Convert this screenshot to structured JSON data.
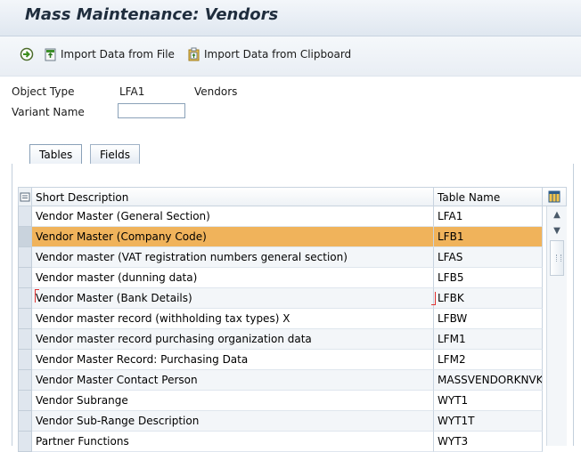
{
  "window": {
    "title": "Mass Maintenance: Vendors"
  },
  "toolbar": {
    "import_file_label": "Import Data from File",
    "import_clipboard_label": "Import Data from Clipboard"
  },
  "header": {
    "object_type_label": "Object Type",
    "object_type_code": "LFA1",
    "object_type_desc": "Vendors",
    "variant_name_label": "Variant Name",
    "variant_name_value": ""
  },
  "tabs": [
    {
      "label": "Tables",
      "active": true
    },
    {
      "label": "Fields",
      "active": false
    }
  ],
  "grid": {
    "columns": [
      "Short Description",
      "Table Name"
    ],
    "rows": [
      {
        "desc": "Vendor Master (General Section)",
        "table": "LFA1"
      },
      {
        "desc": "Vendor Master (Company Code)",
        "table": "LFB1",
        "selected": true
      },
      {
        "desc": "Vendor master (VAT registration numbers general section)",
        "table": "LFAS"
      },
      {
        "desc": "Vendor master (dunning data)",
        "table": "LFB5"
      },
      {
        "desc": "Vendor Master (Bank Details)",
        "table": "LFBK"
      },
      {
        "desc": "Vendor master record (withholding tax types) X",
        "table": "LFBW"
      },
      {
        "desc": "Vendor master record purchasing organization data",
        "table": "LFM1"
      },
      {
        "desc": "Vendor Master Record: Purchasing Data",
        "table": "LFM2"
      },
      {
        "desc": "Vendor Master Contact Person",
        "table": "MASSVENDORKNVK"
      },
      {
        "desc": "Vendor Subrange",
        "table": "WYT1"
      },
      {
        "desc": "Vendor Sub-Range Description",
        "table": "WYT1T"
      },
      {
        "desc": "Partner Functions",
        "table": "WYT3"
      }
    ],
    "highlight_color": "#f0b35b"
  },
  "icons": {
    "execute": "execute-icon",
    "import_file": "upload-file-icon",
    "import_clipboard": "clipboard-icon",
    "config": "layout-config-icon"
  }
}
